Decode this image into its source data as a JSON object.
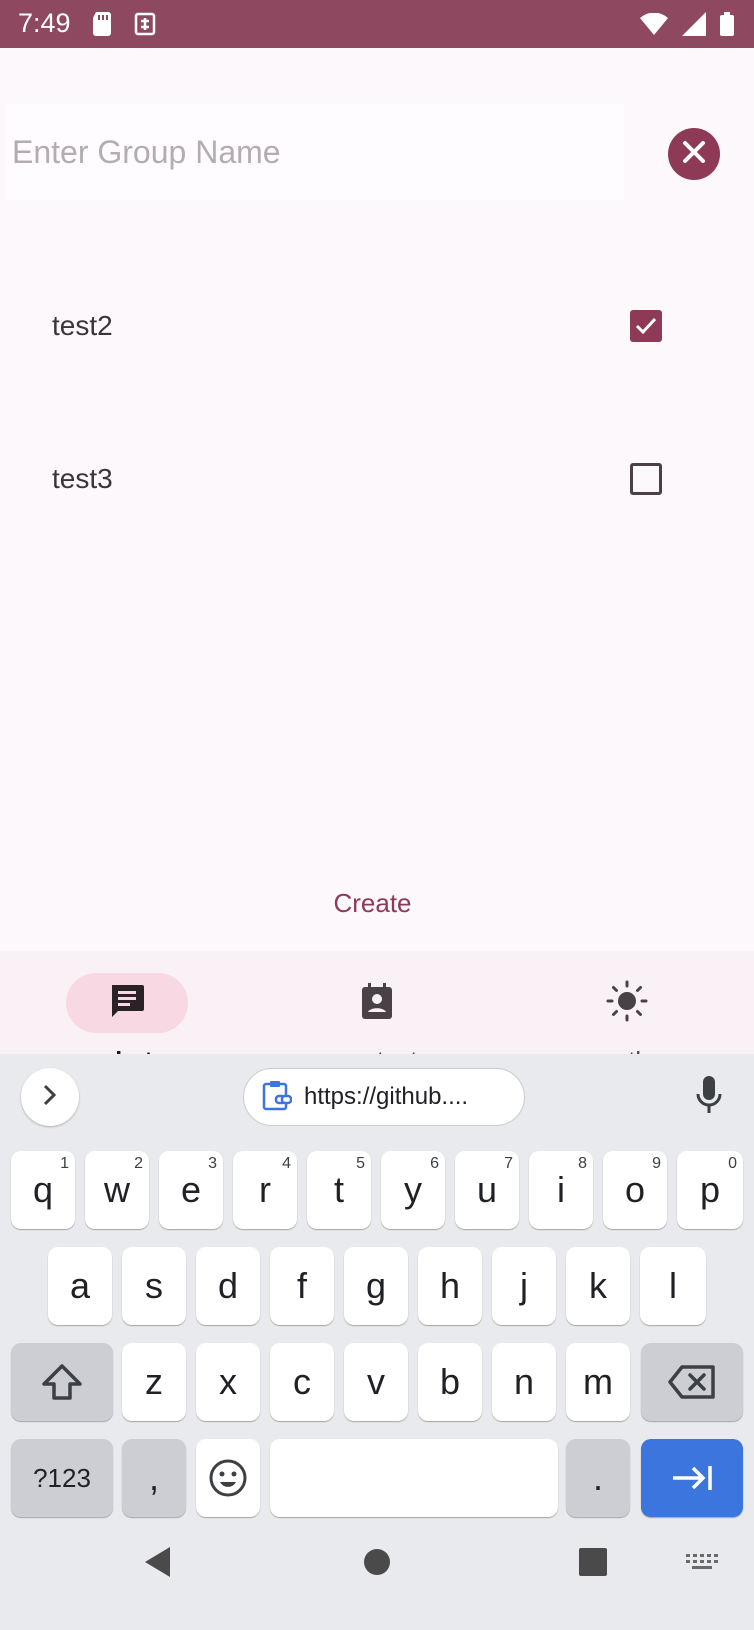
{
  "status_bar": {
    "time": "7:49"
  },
  "group": {
    "placeholder": "Enter Group Name",
    "value": ""
  },
  "contacts": [
    {
      "name": "test2",
      "checked": true
    },
    {
      "name": "test3",
      "checked": false
    }
  ],
  "create_label": "Create",
  "bottom_nav": [
    {
      "label": "chat",
      "icon": "chat-icon",
      "active": true
    },
    {
      "label": "contact",
      "icon": "contact-icon",
      "active": false
    },
    {
      "label": "weather",
      "icon": "sun-icon",
      "active": false
    }
  ],
  "keyboard": {
    "clipboard_text": "https://github....",
    "row1": [
      {
        "k": "q",
        "h": "1"
      },
      {
        "k": "w",
        "h": "2"
      },
      {
        "k": "e",
        "h": "3"
      },
      {
        "k": "r",
        "h": "4"
      },
      {
        "k": "t",
        "h": "5"
      },
      {
        "k": "y",
        "h": "6"
      },
      {
        "k": "u",
        "h": "7"
      },
      {
        "k": "i",
        "h": "8"
      },
      {
        "k": "o",
        "h": "9"
      },
      {
        "k": "p",
        "h": "0"
      }
    ],
    "row2": [
      "a",
      "s",
      "d",
      "f",
      "g",
      "h",
      "j",
      "k",
      "l"
    ],
    "row3": [
      "z",
      "x",
      "c",
      "v",
      "b",
      "n",
      "m"
    ],
    "symbols_label": "?123",
    "comma_label": ",",
    "period_label": "."
  },
  "colors": {
    "accent": "#8e3a56",
    "status_bar": "#8e4860",
    "enter_key": "#3b75dd"
  }
}
